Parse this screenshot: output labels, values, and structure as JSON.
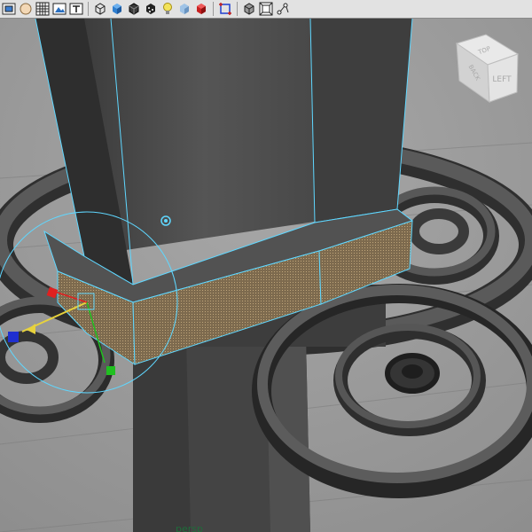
{
  "toolbar": {
    "buttons": [
      {
        "name": "select-camera-icon"
      },
      {
        "name": "shading-icon"
      },
      {
        "name": "grid-icon"
      },
      {
        "name": "image-plane-icon"
      },
      {
        "name": "film-gate-icon"
      },
      {
        "name": "wireframe-cube-icon"
      },
      {
        "name": "smooth-shade-icon"
      },
      {
        "name": "shaded-wireframe-icon"
      },
      {
        "name": "textured-icon"
      },
      {
        "name": "use-lights-icon"
      },
      {
        "name": "shadows-icon"
      },
      {
        "name": "xray-icon"
      },
      {
        "name": "isolate-select-icon"
      },
      {
        "name": "wireframe-on-shaded-icon"
      },
      {
        "name": "resolution-gate-icon"
      },
      {
        "name": "joint-xray-icon"
      }
    ],
    "colors": {
      "background": "#e2e2e2",
      "accent_blue": "#2f7fd0",
      "accent_red": "#c02020",
      "accent_yellow": "#e7d23c"
    }
  },
  "viewport": {
    "camera_label": "persp",
    "view_cube": {
      "face_top": "TOP",
      "face_front": "LEFT",
      "face_side": "BACK"
    },
    "colors": {
      "background": "#9b9b9b",
      "mesh": "#4a4a4a",
      "selection": "#5fd7ff",
      "selected_face": "#8c7a5a",
      "axis_x": "#e02020",
      "axis_y": "#20c020",
      "axis_z": "#2020e0"
    }
  }
}
